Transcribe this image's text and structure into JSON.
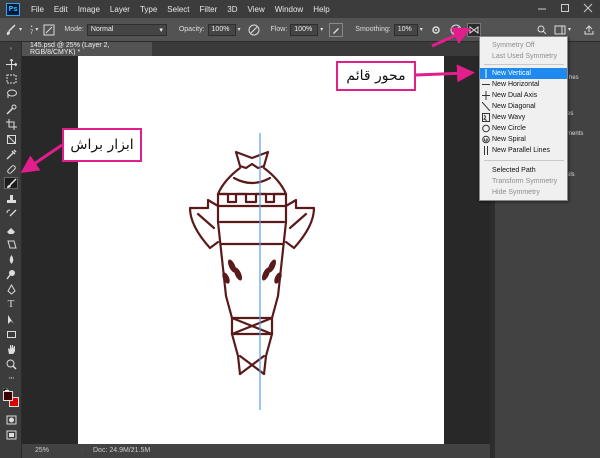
{
  "app": {
    "logo": "Ps",
    "menu": [
      "File",
      "Edit",
      "Image",
      "Layer",
      "Type",
      "Select",
      "Filter",
      "3D",
      "View",
      "Window",
      "Help"
    ]
  },
  "options": {
    "brush_size": "7",
    "mode_label": "Mode:",
    "mode_value": "Normal",
    "opacity_label": "Opacity:",
    "opacity_value": "100%",
    "flow_label": "Flow:",
    "flow_value": "100%",
    "smoothing_label": "Smoothing:",
    "smoothing_value": "10%"
  },
  "document": {
    "tab_title": "145.psd @ 25% (Layer 2, RGB/8/CMYK) *"
  },
  "status": {
    "zoom": "25%",
    "doc_info": "Doc: 24.9M/21.5M"
  },
  "symmetry_menu": {
    "items": [
      {
        "label": "Symmetry Off",
        "state": "disabled"
      },
      {
        "label": "Last Used Symmetry",
        "state": "disabled"
      },
      {
        "label": "New Vertical",
        "state": "selected",
        "icon": "vertical-axis-icon"
      },
      {
        "label": "New Horizontal",
        "state": "normal",
        "icon": "horizontal-axis-icon"
      },
      {
        "label": "New Dual Axis",
        "state": "normal",
        "icon": "dual-axis-icon"
      },
      {
        "label": "New Diagonal",
        "state": "normal",
        "icon": "diagonal-icon"
      },
      {
        "label": "New Wavy",
        "state": "normal",
        "icon": "wavy-icon"
      },
      {
        "label": "New Circle",
        "state": "normal",
        "icon": "circle-icon"
      },
      {
        "label": "New Spiral",
        "state": "normal",
        "icon": "spiral-icon"
      },
      {
        "label": "New Parallel Lines",
        "state": "normal",
        "icon": "parallel-lines-icon"
      },
      {
        "label": "Selected Path",
        "state": "normal"
      },
      {
        "label": "Transform Symmetry",
        "state": "disabled"
      },
      {
        "label": "Hide Symmetry",
        "state": "disabled"
      }
    ]
  },
  "right_panel": {
    "fragments": [
      "hes",
      "es",
      "ments",
      "els"
    ]
  },
  "annotations": {
    "symmetry_axis": "محور قائم",
    "brush_tool": "ابزار براش"
  },
  "colors": {
    "accent_pink": "#e11e8c",
    "menu_selected": "#1e8aef",
    "drawing_stroke": "#5a1a1a",
    "symmetry_line": "#5aa0e6",
    "foreground": "#3a0000",
    "background_swatch": "#e00000"
  }
}
